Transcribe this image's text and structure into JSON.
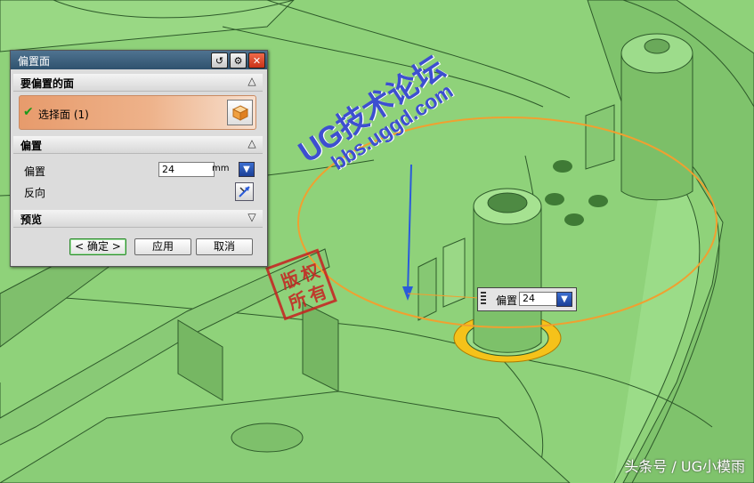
{
  "dialog": {
    "title": "偏置面",
    "section_faces": "要偏置的面",
    "select_face_label": "选择面 (1)",
    "section_offset": "偏置",
    "offset_label": "偏置",
    "offset_value": "24",
    "offset_unit": "mm",
    "reverse_label": "反向",
    "section_preview": "预览",
    "ok_label": "< 确定 >",
    "apply_label": "应用",
    "cancel_label": "取消"
  },
  "float_widget": {
    "label": "偏置",
    "value": "24"
  },
  "watermark": {
    "seal_chars": [
      "版",
      "权",
      "所",
      "有"
    ],
    "line1": "UG技术论坛",
    "line2": "bbs.uggd.com"
  },
  "footer_text": "头条号 / UG小模雨",
  "colors": {
    "model_green": "#8fd27a",
    "edge_dark": "#2e5a2a",
    "highlight_orange": "#f0a030",
    "selected_face": "#f5c21a",
    "handle_blue": "#2a5bd9",
    "watermark_blue": "#3d4fd0",
    "seal_red": "#c82020"
  }
}
